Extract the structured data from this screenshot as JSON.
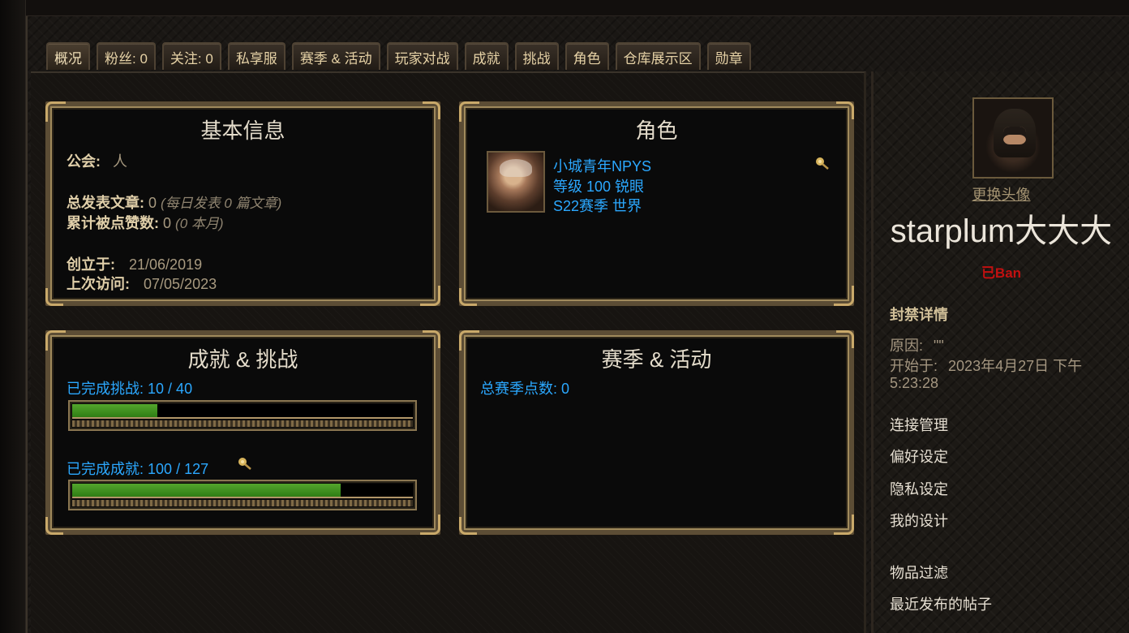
{
  "tabs": [
    "概况",
    "粉丝: 0",
    "关注: 0",
    "私享服",
    "赛季 & 活动",
    "玩家对战",
    "成就",
    "挑战",
    "角色",
    "仓库展示区",
    "勋章"
  ],
  "basic_info": {
    "title": "基本信息",
    "guild_label": "公会:",
    "guild_value": "人",
    "posts_label": "总发表文章:",
    "posts_value": "0",
    "posts_note": "(每日发表 0 篇文章)",
    "likes_label": "累计被点赞数:",
    "likes_value": "0",
    "likes_note": "(0 本月)",
    "created_label": "创立于:",
    "created_value": "21/06/2019",
    "last_visit_label": "上次访问:",
    "last_visit_value": "07/05/2023"
  },
  "character": {
    "title": "角色",
    "name": "小城青年NPYS",
    "level_class": "等级 100 锐眼",
    "season_realm": "S22赛季 世界",
    "portrait_icon": "character-portrait",
    "pin_icon": "pushpin-icon"
  },
  "achievements": {
    "title": "成就 & 挑战",
    "challenges_label": "已完成挑战:",
    "challenges_value": "10 / 40",
    "challenges_progress": 0.25,
    "achievements_label": "已完成成就:",
    "achievements_value": "100 / 127",
    "achievements_progress": 0.787
  },
  "season": {
    "title": "赛季 & 活动",
    "points_label": "总赛季点数:",
    "points_value": "0"
  },
  "profile": {
    "change_avatar": "更换头像",
    "username": "starplum大大大",
    "status": "已Ban",
    "ban_title": "封禁详情",
    "reason_label": "原因:",
    "reason_value": "\"\"",
    "start_label": "开始于:",
    "start_value_1": "2023年4月27日 下午",
    "start_value_2": "5:23:28"
  },
  "sidebar_links": [
    "连接管理",
    "偏好设定",
    "隐私设定",
    "我的设计",
    "物品过滤",
    "最近发布的帖子"
  ],
  "colors": {
    "accent_blue": "#2ba8ff",
    "banned_red": "#c21010",
    "gold_label": "#e0cfa9",
    "progress_green": "#3b9420"
  }
}
